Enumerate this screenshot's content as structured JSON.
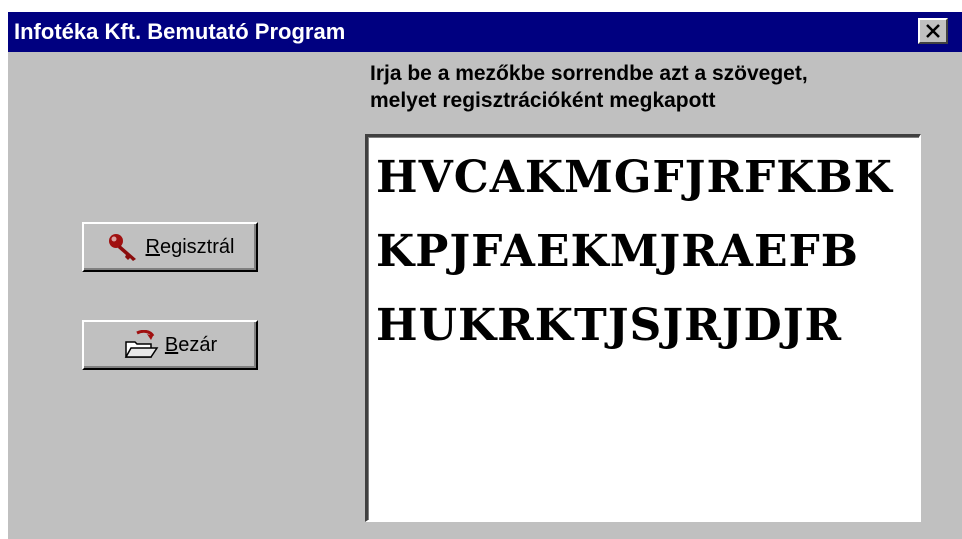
{
  "window": {
    "title": "Infotéka Kft. Bemutató Program"
  },
  "instruction": {
    "line1": "Irja be a mezőkbe sorrendbe  azt a szöveget,",
    "line2": "melyet regisztrációként megkapott"
  },
  "code": {
    "lines": [
      "HVCAKMGFJRFKBK",
      "KPJFAEKMJRAEFB",
      "HUKRKTJSJRJDJR"
    ]
  },
  "buttons": {
    "register": {
      "mnemonic": "R",
      "rest": "egisztrál",
      "icon": "key-icon"
    },
    "close": {
      "mnemonic": "B",
      "rest": "ezár",
      "icon": "open-folder-icon"
    }
  },
  "colors": {
    "titlebar": "#000080",
    "face": "#c0c0c0",
    "icon_red": "#a01010"
  }
}
